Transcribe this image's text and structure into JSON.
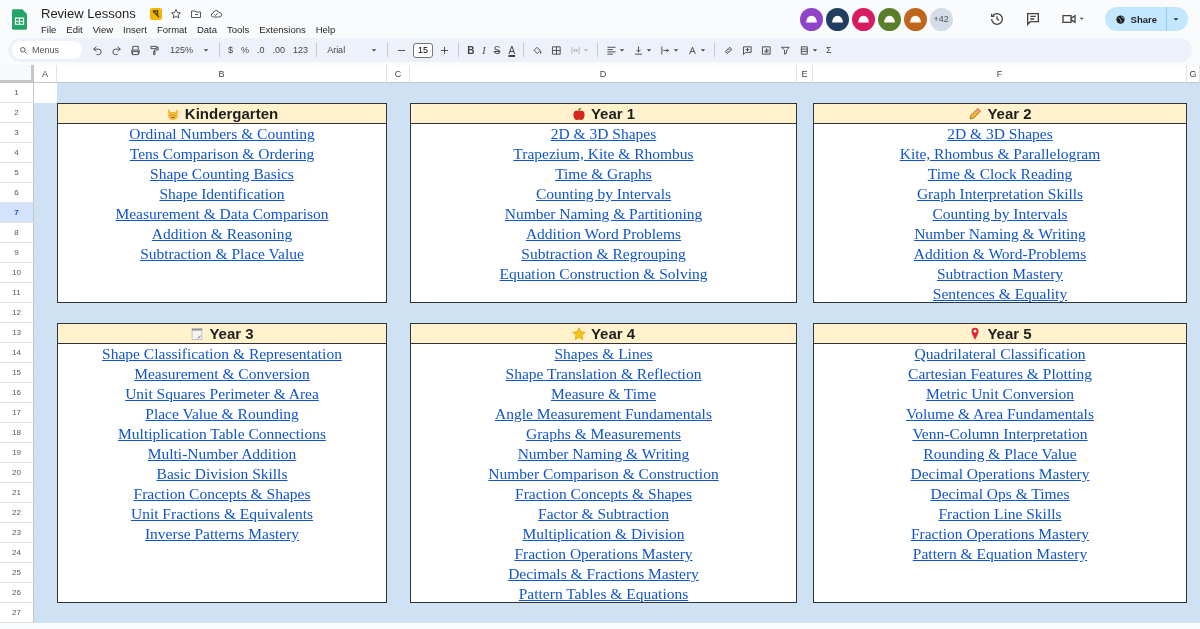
{
  "document": {
    "title": "Review Lessons"
  },
  "menu": [
    "File",
    "Edit",
    "View",
    "Insert",
    "Format",
    "Data",
    "Tools",
    "Extensions",
    "Help"
  ],
  "collaborators": [
    {
      "color": "#8e44c8"
    },
    {
      "color": "#213e5c"
    },
    {
      "color": "#d81b60"
    },
    {
      "color": "#5a7d2a"
    },
    {
      "color": "#c0661c"
    }
  ],
  "collaborators_more": "+42",
  "share_button": "Share",
  "toolbar": [
    {
      "kind": "search",
      "placeholder": "Menus"
    },
    {
      "kind": "undo"
    },
    {
      "kind": "redo"
    },
    {
      "kind": "print"
    },
    {
      "kind": "paint"
    },
    {
      "kind": "dropdown",
      "label": "125%"
    },
    {
      "kind": "separator"
    },
    {
      "kind": "text",
      "label": "$"
    },
    {
      "kind": "text",
      "label": "%"
    },
    {
      "kind": "text",
      "label": ".0"
    },
    {
      "kind": "text",
      "label": ".00"
    },
    {
      "kind": "text",
      "label": "123"
    },
    {
      "kind": "separator"
    },
    {
      "kind": "dropdown",
      "label": "Arial"
    },
    {
      "kind": "separator"
    },
    {
      "kind": "minus"
    },
    {
      "kind": "field",
      "label": "15"
    },
    {
      "kind": "plus"
    },
    {
      "kind": "separator"
    },
    {
      "kind": "bold",
      "label": "B"
    },
    {
      "kind": "italic",
      "label": "I"
    },
    {
      "kind": "strike",
      "label": "S"
    },
    {
      "kind": "textcolor",
      "label": "A"
    },
    {
      "kind": "separator"
    },
    {
      "kind": "fill"
    },
    {
      "kind": "borders"
    },
    {
      "kind": "merge"
    },
    {
      "kind": "separator"
    },
    {
      "kind": "align"
    },
    {
      "kind": "valign"
    },
    {
      "kind": "wrap"
    },
    {
      "kind": "rotate"
    },
    {
      "kind": "separator"
    },
    {
      "kind": "link"
    },
    {
      "kind": "comment"
    },
    {
      "kind": "chart"
    },
    {
      "kind": "filter"
    },
    {
      "kind": "views"
    },
    {
      "kind": "text",
      "label": "Σ"
    }
  ],
  "columns": [
    "A",
    "B",
    "C",
    "D",
    "E",
    "F",
    "G"
  ],
  "rows": [
    {
      "label": "1",
      "selected": false
    },
    {
      "label": "2",
      "selected": false
    },
    {
      "label": "3",
      "selected": false
    },
    {
      "label": "4",
      "selected": false
    },
    {
      "label": "5",
      "selected": false
    },
    {
      "label": "6",
      "selected": false
    },
    {
      "label": "7",
      "selected": true
    },
    {
      "label": "8",
      "selected": false
    },
    {
      "label": "9",
      "selected": false
    },
    {
      "label": "10",
      "selected": false
    },
    {
      "label": "11",
      "selected": false
    },
    {
      "label": "12",
      "selected": false
    },
    {
      "label": "13",
      "selected": false
    },
    {
      "label": "14",
      "selected": false
    },
    {
      "label": "15",
      "selected": false
    },
    {
      "label": "16",
      "selected": false
    },
    {
      "label": "17",
      "selected": false
    },
    {
      "label": "18",
      "selected": false
    },
    {
      "label": "19",
      "selected": false
    },
    {
      "label": "20",
      "selected": false
    },
    {
      "label": "21",
      "selected": false
    },
    {
      "label": "22",
      "selected": false
    },
    {
      "label": "23",
      "selected": false
    },
    {
      "label": "24",
      "selected": false
    },
    {
      "label": "25",
      "selected": false
    },
    {
      "label": "26",
      "selected": false
    },
    {
      "label": "27",
      "selected": false
    }
  ],
  "cards": [
    {
      "title": "Kindergarten",
      "kind": "cat",
      "links": [
        "Ordinal Numbers & Counting",
        "Tens Comparison & Ordering",
        "Shape Counting Basics",
        "Shape Identification",
        "Measurement & Data Comparison",
        "Addition & Reasoning",
        "Subtraction & Place Value"
      ]
    },
    {
      "title": "Year 1",
      "kind": "apple",
      "links": [
        "2D & 3D Shapes",
        "Trapezium, Kite & Rhombus",
        "Time & Graphs",
        "Counting by Intervals",
        "Number Naming & Partitioning",
        "Addition Word Problems",
        "Subtraction & Regrouping",
        "Equation Construction & Solving"
      ]
    },
    {
      "title": "Year 2",
      "kind": "pencil",
      "links": [
        "2D & 3D Shapes",
        "Kite, Rhombus & Parallelogram",
        "Time & Clock Reading",
        "Graph Interpretation Skills",
        "Counting by Intervals",
        "Number Naming & Writing",
        "Addition & Word-Problems",
        "Subtraction Mastery",
        "Sentences & Equality"
      ]
    },
    {
      "title": "Year 3",
      "kind": "notepad",
      "links": [
        "Shape Classification & Representation",
        "Measurement & Conversion",
        "Unit Squares Perimeter & Area",
        "Place Value & Rounding",
        "Multiplication Table Connections",
        "Multi-Number Addition",
        "Basic Division Skills",
        "Fraction Concepts & Shapes",
        "Unit Fractions & Equivalents",
        "Inverse Patterns Mastery"
      ]
    },
    {
      "title": "Year 4",
      "kind": "star",
      "links": [
        "Shapes & Lines",
        "Shape Translation & Reflection",
        "Measure & Time",
        "Angle Measurement Fundamentals",
        "Graphs & Measurements",
        "Number Naming & Writing",
        "Number Comparison & Construction",
        "Fraction Concepts & Shapes",
        "Factor & Subtraction",
        "Multiplication & Division",
        "Fraction Operations Mastery",
        "Decimals & Fractions Mastery",
        "Pattern Tables & Equations"
      ]
    },
    {
      "title": "Year 5",
      "kind": "pin",
      "links": [
        "Quadrilateral Classification",
        "Cartesian Features & Plotting",
        "Metric Unit Conversion",
        "Volume & Area Fundamentals",
        "Venn-Column Interpretation",
        "Rounding & Place Value",
        "Decimal Operations Mastery",
        "Decimal Ops & Times",
        "Fraction Line Skills",
        "Fraction Operations Mastery",
        "Pattern & Equation Mastery"
      ]
    }
  ]
}
